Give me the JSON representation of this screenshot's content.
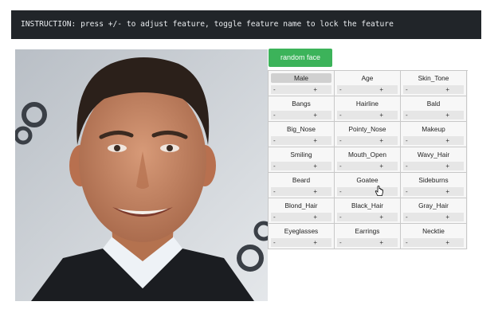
{
  "instruction": "INSTRUCTION: press +/- to adjust feature, toggle feature name to lock the feature",
  "random_face_label": "random face",
  "features": [
    {
      "name": "Male",
      "locked": true
    },
    {
      "name": "Age",
      "locked": false
    },
    {
      "name": "Skin_Tone",
      "locked": false
    },
    {
      "name": "Bangs",
      "locked": false
    },
    {
      "name": "Hairline",
      "locked": false
    },
    {
      "name": "Bald",
      "locked": false
    },
    {
      "name": "Big_Nose",
      "locked": false
    },
    {
      "name": "Pointy_Nose",
      "locked": false
    },
    {
      "name": "Makeup",
      "locked": false
    },
    {
      "name": "Smiling",
      "locked": false
    },
    {
      "name": "Mouth_Open",
      "locked": false
    },
    {
      "name": "Wavy_Hair",
      "locked": false
    },
    {
      "name": "Beard",
      "locked": false
    },
    {
      "name": "Goatee",
      "locked": false
    },
    {
      "name": "Sideburns",
      "locked": false
    },
    {
      "name": "Blond_Hair",
      "locked": false
    },
    {
      "name": "Black_Hair",
      "locked": false
    },
    {
      "name": "Gray_Hair",
      "locked": false
    },
    {
      "name": "Eyeglasses",
      "locked": false
    },
    {
      "name": "Earrings",
      "locked": false
    },
    {
      "name": "Necktie",
      "locked": false
    }
  ],
  "minus_label": "-",
  "plus_label": "+",
  "colors": {
    "button_green": "#3cb35a",
    "banner_bg": "#212529"
  }
}
